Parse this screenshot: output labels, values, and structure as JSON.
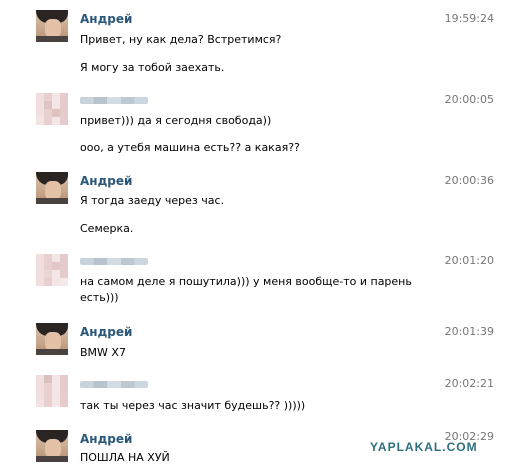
{
  "messages": [
    {
      "author": "Андрей",
      "time": "19:59:24",
      "lines": [
        "Привет, ну как дела? Встретимся?",
        "Я могу за тобой заехать."
      ]
    },
    {
      "author": "",
      "time": "20:00:05",
      "lines": [
        "привет))) да я сегодня свобода))",
        "ооо, а утебя машина есть?? а какая??"
      ]
    },
    {
      "author": "Андрей",
      "time": "20:00:36",
      "lines": [
        "Я тогда заеду через час.",
        "Семерка."
      ]
    },
    {
      "author": "",
      "time": "20:01:20",
      "lines": [
        "на самом деле я пошутила))) у меня вообще-то и парень",
        "есть)))"
      ]
    },
    {
      "author": "Андрей",
      "time": "20:01:39",
      "lines": [
        "BMW X7"
      ]
    },
    {
      "author": "",
      "time": "20:02:21",
      "lines": [
        "так ты через час значит будешь?? )))))"
      ]
    },
    {
      "author": "Андрей",
      "time": "20:02:29",
      "lines": [
        "ПОШЛА НА ХУЙ"
      ]
    }
  ],
  "watermark": "YAPLAKAL.COM"
}
